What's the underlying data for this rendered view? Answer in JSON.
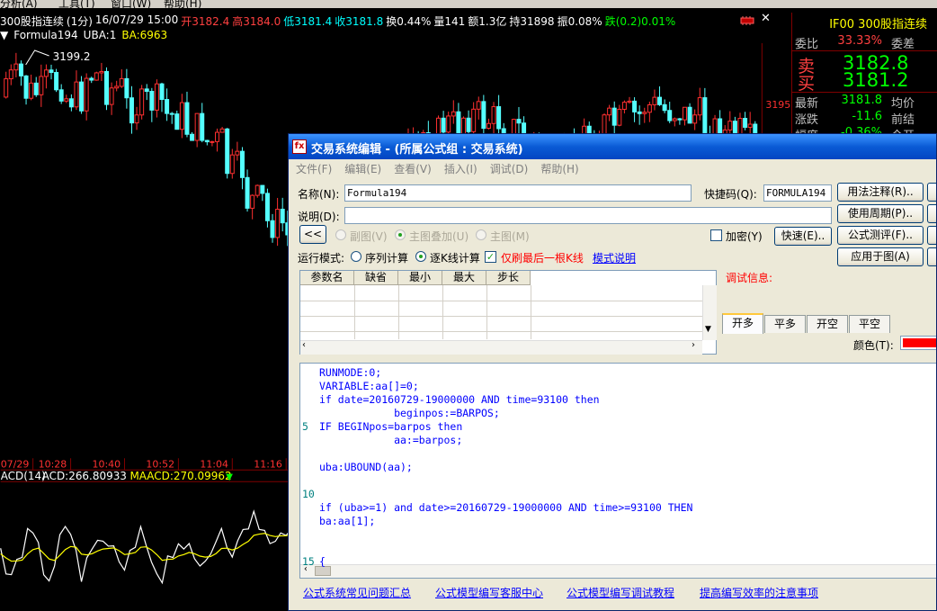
{
  "menu": [
    "分析(A)",
    "工具(T)",
    "窗口(W)",
    "帮助(H)"
  ],
  "chart_header": {
    "name": "300股指连续",
    "period": "(1分)",
    "datetime": "16/07/29 15:00",
    "open_label": "开",
    "open_value": "3182.4",
    "high_label": "高",
    "high_value": "3184.0",
    "low_label": "低",
    "low_value": "3181.4",
    "close_label": "收",
    "close_value": "3181.8",
    "turnover": "换0.44%",
    "volume": "量141",
    "amount": "额1.3亿",
    "holding": "持31898",
    "amplitude": "振0.08%",
    "change": "跌(0.2)0.01%",
    "formula": "Formula194",
    "uba": "UBA:1",
    "ba": "BA:6963"
  },
  "chart_annot": {
    "peak": "3199.2",
    "price_tick": "3195",
    "time_ticks": [
      "07/29",
      "10:28",
      "10:40",
      "10:52",
      "11:04",
      "11:16",
      "11:"
    ],
    "acd_name": "ACD(14)",
    "acd_value": "ACD:266.80933",
    "maacd_value": "MAACD:270.09962",
    "maacd_arrow": "▼"
  },
  "quote": {
    "title": "IF00  300股指连续",
    "rows": [
      {
        "l": "委比",
        "v": "33.33%",
        "r": "委差",
        "color": "#ff4040"
      },
      {
        "l": "最新",
        "v": "3181.8",
        "r": "均价",
        "color": "#00ff00"
      },
      {
        "l": "涨跌",
        "v": "-11.6",
        "r": "前结",
        "color": "#00ff00"
      },
      {
        "l": "幅度",
        "v": "-0.36%",
        "r": "今开",
        "color": "#00ff00"
      }
    ],
    "sell_label": "卖",
    "sell_value": "3182.8",
    "buy_label": "买",
    "buy_value": "3181.2"
  },
  "dialog": {
    "title": "交易系统编辑 - (所属公式组 : 交易系统)",
    "menu": [
      "文件(F)",
      "编辑(E)",
      "查看(V)",
      "插入(I)",
      "调试(D)",
      "帮助(H)"
    ],
    "name_label": "名称(N):",
    "name_value": "Formula194",
    "shortcut_label": "快捷码(Q):",
    "shortcut_value": "FORMULA194",
    "desc_label": "说明(D):",
    "desc_value": "",
    "collapse_btn": "<<",
    "sub_chart": "副图(V)",
    "main_overlay": "主图叠加(U)",
    "main_chart": "主图(M)",
    "encrypt": "加密(Y)",
    "quick_btn": "快速(E)..",
    "run_mode_label": "运行模式:",
    "seq_calc": "序列计算",
    "kline_calc": "逐K线计算",
    "last_only": "仅刷最后一根K线",
    "mode_help": "模式说明",
    "buttons": [
      "用法注释(R)..",
      "使用周期(P)..",
      "公式测评(F)..",
      "应用于图(A)"
    ],
    "grid_headers": [
      "参数名",
      "缺省",
      "最小",
      "最大",
      "步长"
    ],
    "debug_label": "调试信息:",
    "tabs": [
      "开多",
      "平多",
      "开空",
      "平空"
    ],
    "color_label": "颜色(T):",
    "color_value": "#ff0000",
    "code": [
      {
        "n": "",
        "t": "RUNMODE:0;"
      },
      {
        "n": "",
        "t": "VARIABLE:aa[]=0;"
      },
      {
        "n": "",
        "t": "if date=20160729-19000000 AND time=93100 then"
      },
      {
        "n": "",
        "t": "            beginpos:=BARPOS;"
      },
      {
        "n": "5",
        "t": "IF BEGINpos=barpos then"
      },
      {
        "n": "",
        "t": "            aa:=barpos;"
      },
      {
        "n": "",
        "t": ""
      },
      {
        "n": "",
        "t": "uba:UBOUND(aa);"
      },
      {
        "n": "",
        "t": ""
      },
      {
        "n": "10",
        "t": ""
      },
      {
        "n": "",
        "t": "if (uba>=1) and date>=20160729-19000000 AND time>=93100 THEN"
      },
      {
        "n": "",
        "t": "ba:aa[1];"
      },
      {
        "n": "",
        "t": ""
      },
      {
        "n": "",
        "t": ""
      },
      {
        "n": "15",
        "t": "{"
      }
    ],
    "links": [
      "公式系统常见问题汇总",
      "公式模型编写客服中心",
      "公式模型编写调试教程",
      "提高编写效率的注意事项"
    ]
  },
  "colors": {
    "up": "#ff3030",
    "down": "#54ffff",
    "acd": "#ffffff",
    "maacd": "#ffff00",
    "axis": "#800000"
  }
}
